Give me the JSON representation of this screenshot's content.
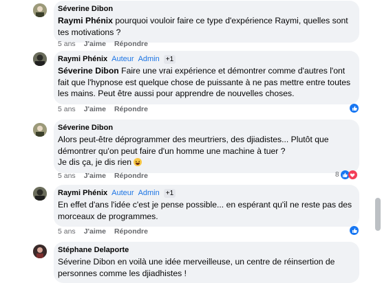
{
  "comments": [
    {
      "author": "Séverine Dibon",
      "text_mention": "Raymi Phénix",
      "text": " pourquoi vouloir faire ce type d'expérience Raymi, quelles sont tes motivations ?",
      "time": "5 ans",
      "like_label": "J'aime",
      "reply_label": "Répondre"
    },
    {
      "author": "Raymi Phénix",
      "badge1": "Auteur",
      "badge2": "Admin",
      "plus": "+1",
      "text_mention": "Séverine Dibon",
      "text": " Faire une vrai expérience et démontrer comme d'autres l'ont fait que l'hypnose est quelque chose de puissante à ne pas mettre entre toutes les mains. Peut être aussi pour apprendre de nouvelles choses.",
      "time": "5 ans",
      "like_label": "J'aime",
      "reply_label": "Répondre"
    },
    {
      "author": "Séverine Dibon",
      "text1": "Alors peut-être déprogrammer des meurtriers, des djiadistes... Plutôt que démontrer qu'on peut faire d'un homme une machine à tuer ?",
      "text2": "Je dis ça, je dis rien",
      "time": "5 ans",
      "like_label": "J'aime",
      "reply_label": "Répondre",
      "reaction_count": "8"
    },
    {
      "author": "Raymi Phénix",
      "badge1": "Auteur",
      "badge2": "Admin",
      "plus": "+1",
      "text": "En effet d'ans l'idée c'est je pense possible... en espérant qu'il ne reste pas des morceaux de programmes.",
      "time": "5 ans",
      "like_label": "J'aime",
      "reply_label": "Répondre"
    },
    {
      "author": "Stéphane Delaporte",
      "text_mention": "Séverine Dibon",
      "text": " en voilà une idée merveilleuse, un centre de réinsertion de personnes comme les djiadhistes !"
    }
  ],
  "colors": {
    "bubble": "#f0f2f5",
    "accent": "#1877f2",
    "love": "#f33e58",
    "meta": "#65676b"
  }
}
